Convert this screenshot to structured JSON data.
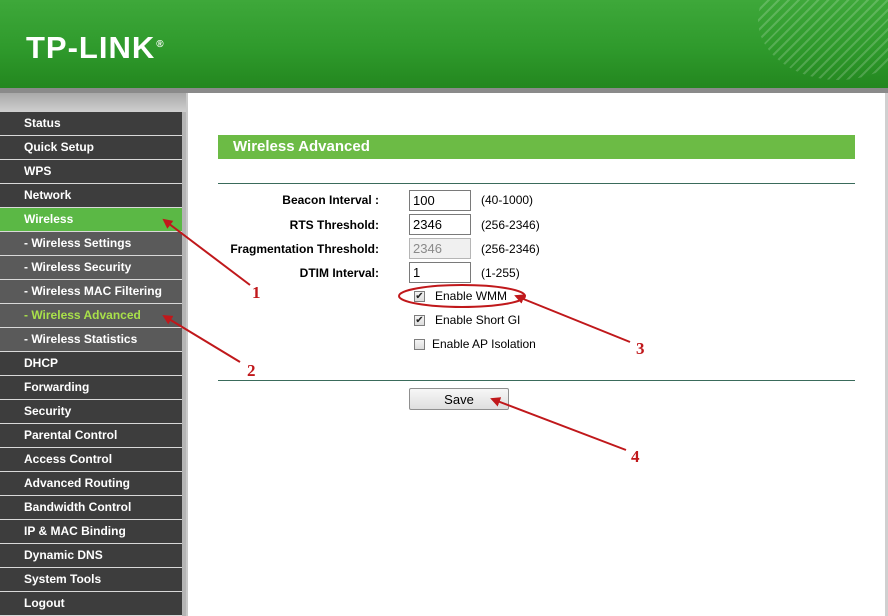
{
  "header": {
    "logo_text": "TP-LINK",
    "logo_mark": "®"
  },
  "sidebar": {
    "items": [
      {
        "label": "Status"
      },
      {
        "label": "Quick Setup"
      },
      {
        "label": "WPS"
      },
      {
        "label": "Network"
      },
      {
        "label": "Wireless",
        "active": true
      },
      {
        "label": "- Wireless Settings",
        "sub": true
      },
      {
        "label": "- Wireless Security",
        "sub": true
      },
      {
        "label": "- Wireless MAC Filtering",
        "sub": true
      },
      {
        "label": "- Wireless Advanced",
        "sub": true,
        "current": true
      },
      {
        "label": "- Wireless Statistics",
        "sub": true
      },
      {
        "label": "DHCP"
      },
      {
        "label": "Forwarding"
      },
      {
        "label": "Security"
      },
      {
        "label": "Parental Control"
      },
      {
        "label": "Access Control"
      },
      {
        "label": "Advanced Routing"
      },
      {
        "label": "Bandwidth Control"
      },
      {
        "label": "IP & MAC Binding"
      },
      {
        "label": "Dynamic DNS"
      },
      {
        "label": "System Tools"
      },
      {
        "label": "Logout"
      }
    ]
  },
  "main": {
    "section_title": "Wireless Advanced",
    "fields": {
      "beacon": {
        "label": "Beacon Interval :",
        "value": "100",
        "range": "(40-1000)"
      },
      "rts": {
        "label": "RTS Threshold:",
        "value": "2346",
        "range": "(256-2346)"
      },
      "frag": {
        "label": "Fragmentation Threshold:",
        "value": "2346",
        "range": "(256-2346)",
        "disabled": true
      },
      "dtim": {
        "label": "DTIM Interval:",
        "value": "1",
        "range": "(1-255)"
      }
    },
    "options": {
      "wmm": {
        "label": "Enable WMM",
        "checked": true
      },
      "short_gi": {
        "label": "Enable Short GI",
        "checked": true
      },
      "ap_isolation": {
        "label": "Enable AP Isolation",
        "checked": false
      }
    },
    "save_label": "Save"
  },
  "annotations": {
    "color": "#c0181b",
    "labels": [
      "1",
      "2",
      "3",
      "4"
    ]
  },
  "colors": {
    "brand_green": "#2f9a2c",
    "active_nav": "#5bb845",
    "current_sub_text": "#a8e04a",
    "section_bar": "#6cbb45"
  }
}
